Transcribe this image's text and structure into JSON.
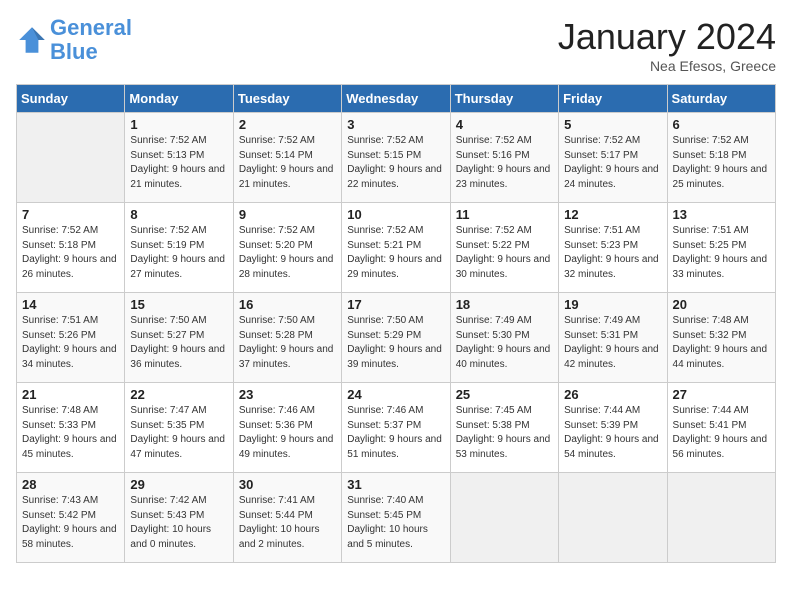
{
  "header": {
    "logo_line1": "General",
    "logo_line2": "Blue",
    "title": "January 2024",
    "subtitle": "Nea Efesos, Greece"
  },
  "weekdays": [
    "Sunday",
    "Monday",
    "Tuesday",
    "Wednesday",
    "Thursday",
    "Friday",
    "Saturday"
  ],
  "weeks": [
    [
      {
        "day": "",
        "sunrise": "",
        "sunset": "",
        "daylight": ""
      },
      {
        "day": "1",
        "sunrise": "Sunrise: 7:52 AM",
        "sunset": "Sunset: 5:13 PM",
        "daylight": "Daylight: 9 hours and 21 minutes."
      },
      {
        "day": "2",
        "sunrise": "Sunrise: 7:52 AM",
        "sunset": "Sunset: 5:14 PM",
        "daylight": "Daylight: 9 hours and 21 minutes."
      },
      {
        "day": "3",
        "sunrise": "Sunrise: 7:52 AM",
        "sunset": "Sunset: 5:15 PM",
        "daylight": "Daylight: 9 hours and 22 minutes."
      },
      {
        "day": "4",
        "sunrise": "Sunrise: 7:52 AM",
        "sunset": "Sunset: 5:16 PM",
        "daylight": "Daylight: 9 hours and 23 minutes."
      },
      {
        "day": "5",
        "sunrise": "Sunrise: 7:52 AM",
        "sunset": "Sunset: 5:17 PM",
        "daylight": "Daylight: 9 hours and 24 minutes."
      },
      {
        "day": "6",
        "sunrise": "Sunrise: 7:52 AM",
        "sunset": "Sunset: 5:18 PM",
        "daylight": "Daylight: 9 hours and 25 minutes."
      }
    ],
    [
      {
        "day": "7",
        "sunrise": "Sunrise: 7:52 AM",
        "sunset": "Sunset: 5:18 PM",
        "daylight": "Daylight: 9 hours and 26 minutes."
      },
      {
        "day": "8",
        "sunrise": "Sunrise: 7:52 AM",
        "sunset": "Sunset: 5:19 PM",
        "daylight": "Daylight: 9 hours and 27 minutes."
      },
      {
        "day": "9",
        "sunrise": "Sunrise: 7:52 AM",
        "sunset": "Sunset: 5:20 PM",
        "daylight": "Daylight: 9 hours and 28 minutes."
      },
      {
        "day": "10",
        "sunrise": "Sunrise: 7:52 AM",
        "sunset": "Sunset: 5:21 PM",
        "daylight": "Daylight: 9 hours and 29 minutes."
      },
      {
        "day": "11",
        "sunrise": "Sunrise: 7:52 AM",
        "sunset": "Sunset: 5:22 PM",
        "daylight": "Daylight: 9 hours and 30 minutes."
      },
      {
        "day": "12",
        "sunrise": "Sunrise: 7:51 AM",
        "sunset": "Sunset: 5:23 PM",
        "daylight": "Daylight: 9 hours and 32 minutes."
      },
      {
        "day": "13",
        "sunrise": "Sunrise: 7:51 AM",
        "sunset": "Sunset: 5:25 PM",
        "daylight": "Daylight: 9 hours and 33 minutes."
      }
    ],
    [
      {
        "day": "14",
        "sunrise": "Sunrise: 7:51 AM",
        "sunset": "Sunset: 5:26 PM",
        "daylight": "Daylight: 9 hours and 34 minutes."
      },
      {
        "day": "15",
        "sunrise": "Sunrise: 7:50 AM",
        "sunset": "Sunset: 5:27 PM",
        "daylight": "Daylight: 9 hours and 36 minutes."
      },
      {
        "day": "16",
        "sunrise": "Sunrise: 7:50 AM",
        "sunset": "Sunset: 5:28 PM",
        "daylight": "Daylight: 9 hours and 37 minutes."
      },
      {
        "day": "17",
        "sunrise": "Sunrise: 7:50 AM",
        "sunset": "Sunset: 5:29 PM",
        "daylight": "Daylight: 9 hours and 39 minutes."
      },
      {
        "day": "18",
        "sunrise": "Sunrise: 7:49 AM",
        "sunset": "Sunset: 5:30 PM",
        "daylight": "Daylight: 9 hours and 40 minutes."
      },
      {
        "day": "19",
        "sunrise": "Sunrise: 7:49 AM",
        "sunset": "Sunset: 5:31 PM",
        "daylight": "Daylight: 9 hours and 42 minutes."
      },
      {
        "day": "20",
        "sunrise": "Sunrise: 7:48 AM",
        "sunset": "Sunset: 5:32 PM",
        "daylight": "Daylight: 9 hours and 44 minutes."
      }
    ],
    [
      {
        "day": "21",
        "sunrise": "Sunrise: 7:48 AM",
        "sunset": "Sunset: 5:33 PM",
        "daylight": "Daylight: 9 hours and 45 minutes."
      },
      {
        "day": "22",
        "sunrise": "Sunrise: 7:47 AM",
        "sunset": "Sunset: 5:35 PM",
        "daylight": "Daylight: 9 hours and 47 minutes."
      },
      {
        "day": "23",
        "sunrise": "Sunrise: 7:46 AM",
        "sunset": "Sunset: 5:36 PM",
        "daylight": "Daylight: 9 hours and 49 minutes."
      },
      {
        "day": "24",
        "sunrise": "Sunrise: 7:46 AM",
        "sunset": "Sunset: 5:37 PM",
        "daylight": "Daylight: 9 hours and 51 minutes."
      },
      {
        "day": "25",
        "sunrise": "Sunrise: 7:45 AM",
        "sunset": "Sunset: 5:38 PM",
        "daylight": "Daylight: 9 hours and 53 minutes."
      },
      {
        "day": "26",
        "sunrise": "Sunrise: 7:44 AM",
        "sunset": "Sunset: 5:39 PM",
        "daylight": "Daylight: 9 hours and 54 minutes."
      },
      {
        "day": "27",
        "sunrise": "Sunrise: 7:44 AM",
        "sunset": "Sunset: 5:41 PM",
        "daylight": "Daylight: 9 hours and 56 minutes."
      }
    ],
    [
      {
        "day": "28",
        "sunrise": "Sunrise: 7:43 AM",
        "sunset": "Sunset: 5:42 PM",
        "daylight": "Daylight: 9 hours and 58 minutes."
      },
      {
        "day": "29",
        "sunrise": "Sunrise: 7:42 AM",
        "sunset": "Sunset: 5:43 PM",
        "daylight": "Daylight: 10 hours and 0 minutes."
      },
      {
        "day": "30",
        "sunrise": "Sunrise: 7:41 AM",
        "sunset": "Sunset: 5:44 PM",
        "daylight": "Daylight: 10 hours and 2 minutes."
      },
      {
        "day": "31",
        "sunrise": "Sunrise: 7:40 AM",
        "sunset": "Sunset: 5:45 PM",
        "daylight": "Daylight: 10 hours and 5 minutes."
      },
      {
        "day": "",
        "sunrise": "",
        "sunset": "",
        "daylight": ""
      },
      {
        "day": "",
        "sunrise": "",
        "sunset": "",
        "daylight": ""
      },
      {
        "day": "",
        "sunrise": "",
        "sunset": "",
        "daylight": ""
      }
    ]
  ]
}
